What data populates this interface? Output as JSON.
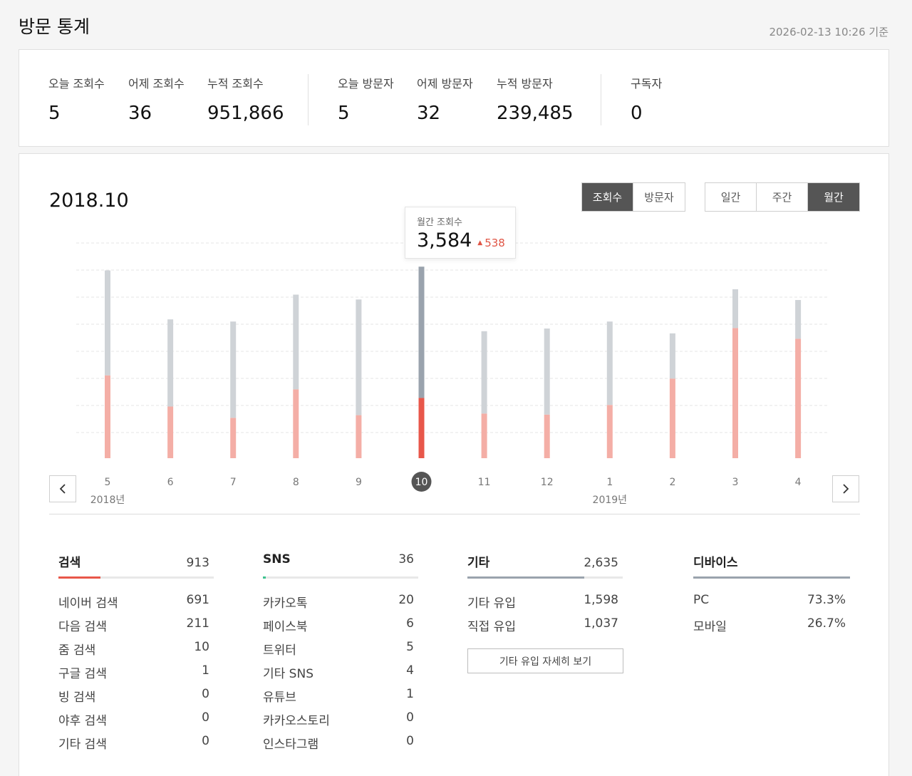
{
  "page": {
    "title": "방문 통계",
    "timestamp": "2026-02-13 10:26 기준"
  },
  "summary": {
    "stats": [
      {
        "label": "오늘 조회수",
        "value": "5"
      },
      {
        "label": "어제 조회수",
        "value": "36"
      },
      {
        "label": "누적 조회수",
        "value": "951,866"
      },
      {
        "label": "오늘 방문자",
        "value": "5"
      },
      {
        "label": "어제 방문자",
        "value": "32"
      },
      {
        "label": "누적 방문자",
        "value": "239,485"
      },
      {
        "label": "구독자",
        "value": "0"
      }
    ]
  },
  "chart_panel": {
    "period": "2018.10",
    "metric_tabs": [
      {
        "label": "조회수",
        "active": true
      },
      {
        "label": "방문자",
        "active": false
      }
    ],
    "range_tabs": [
      {
        "label": "일간",
        "active": false
      },
      {
        "label": "주간",
        "active": false
      },
      {
        "label": "월간",
        "active": true
      }
    ],
    "tooltip": {
      "label": "월간 조회수",
      "value": "3,584",
      "delta": "538",
      "delta_direction": "up"
    },
    "nav": {
      "prev": "chevron-left-icon",
      "next": "chevron-right-icon"
    }
  },
  "chart_data": {
    "type": "bar",
    "stacked": true,
    "categories": [
      "5",
      "6",
      "7",
      "8",
      "9",
      "10",
      "11",
      "12",
      "1",
      "2",
      "3",
      "4"
    ],
    "year_labels": [
      {
        "text": "2018년",
        "at": "5"
      },
      {
        "text": "2019년",
        "at": "1"
      }
    ],
    "selected": "10",
    "series": [
      {
        "values": [
          1540,
          960,
          750,
          1280,
          800,
          1120,
          830,
          810,
          990,
          1480,
          2420,
          2220
        ],
        "color": "#f4aea6",
        "selected_color": "#e8574a"
      },
      {
        "values": [
          1970,
          1640,
          1810,
          1780,
          2170,
          2460,
          1550,
          1620,
          1570,
          860,
          740,
          740
        ],
        "color": "#cfd3d7",
        "selected_color": "#9aa3ad"
      }
    ],
    "ylim": [
      0,
      4000
    ],
    "grid": "horizontal-dashed",
    "colors": {
      "accent": "#e8574a"
    }
  },
  "sources": [
    {
      "title": "검색",
      "total": "913",
      "bar_color": "#e8574a",
      "bar_fraction": 0.27,
      "rows": [
        {
          "label": "네이버 검색",
          "value": "691"
        },
        {
          "label": "다음 검색",
          "value": "211"
        },
        {
          "label": "줌 검색",
          "value": "10"
        },
        {
          "label": "구글 검색",
          "value": "1"
        },
        {
          "label": "빙 검색",
          "value": "0"
        },
        {
          "label": "야후 검색",
          "value": "0"
        },
        {
          "label": "기타 검색",
          "value": "0"
        }
      ]
    },
    {
      "title": "SNS",
      "total": "36",
      "bar_color": "#3ec28f",
      "bar_fraction": 0.02,
      "rows": [
        {
          "label": "카카오톡",
          "value": "20"
        },
        {
          "label": "페이스북",
          "value": "6"
        },
        {
          "label": "트위터",
          "value": "5"
        },
        {
          "label": "기타 SNS",
          "value": "4"
        },
        {
          "label": "유튜브",
          "value": "1"
        },
        {
          "label": "카카오스토리",
          "value": "0"
        },
        {
          "label": "인스타그램",
          "value": "0"
        }
      ]
    },
    {
      "title": "기타",
      "total": "2,635",
      "bar_color": "#9aa3ad",
      "bar_fraction": 0.75,
      "rows": [
        {
          "label": "기타 유입",
          "value": "1,598"
        },
        {
          "label": "직접 유입",
          "value": "1,037"
        }
      ],
      "button": "기타 유입 자세히 보기"
    },
    {
      "title": "디바이스",
      "total": "",
      "bar_color": "#9aa3ad",
      "bar_fraction": 1.0,
      "rows": [
        {
          "label": "PC",
          "value": "73.3%"
        },
        {
          "label": "모바일",
          "value": "26.7%"
        }
      ]
    }
  ]
}
